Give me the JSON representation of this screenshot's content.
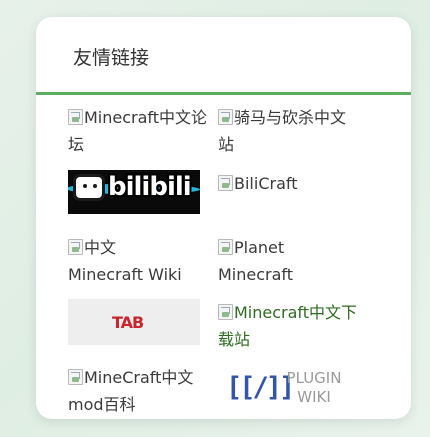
{
  "section": {
    "title": "友情链接",
    "accent": "#5aae62"
  },
  "links": [
    {
      "alt": "Minecraft中文论坛",
      "icon": "broken-image-icon"
    },
    {
      "alt": "骑马与砍杀中文站",
      "icon": "broken-image-icon"
    },
    {
      "logo": "bilibili"
    },
    {
      "alt": "BiliCraft",
      "icon": "broken-image-icon"
    },
    {
      "alt": "中文 Minecraft Wiki",
      "icon": "broken-image-icon"
    },
    {
      "alt": "Planet Minecraft",
      "icon": "broken-image-icon"
    },
    {
      "logo": "TAB"
    },
    {
      "alt": "Minecraft中文下载站",
      "icon": "broken-image-icon"
    },
    {
      "alt": "MineCraft中文mod百科",
      "icon": "broken-image-icon"
    },
    {
      "logo_brackets": "[[/]]",
      "logo_line1": "PLUGIN",
      "logo_line2": "WIKI"
    }
  ]
}
